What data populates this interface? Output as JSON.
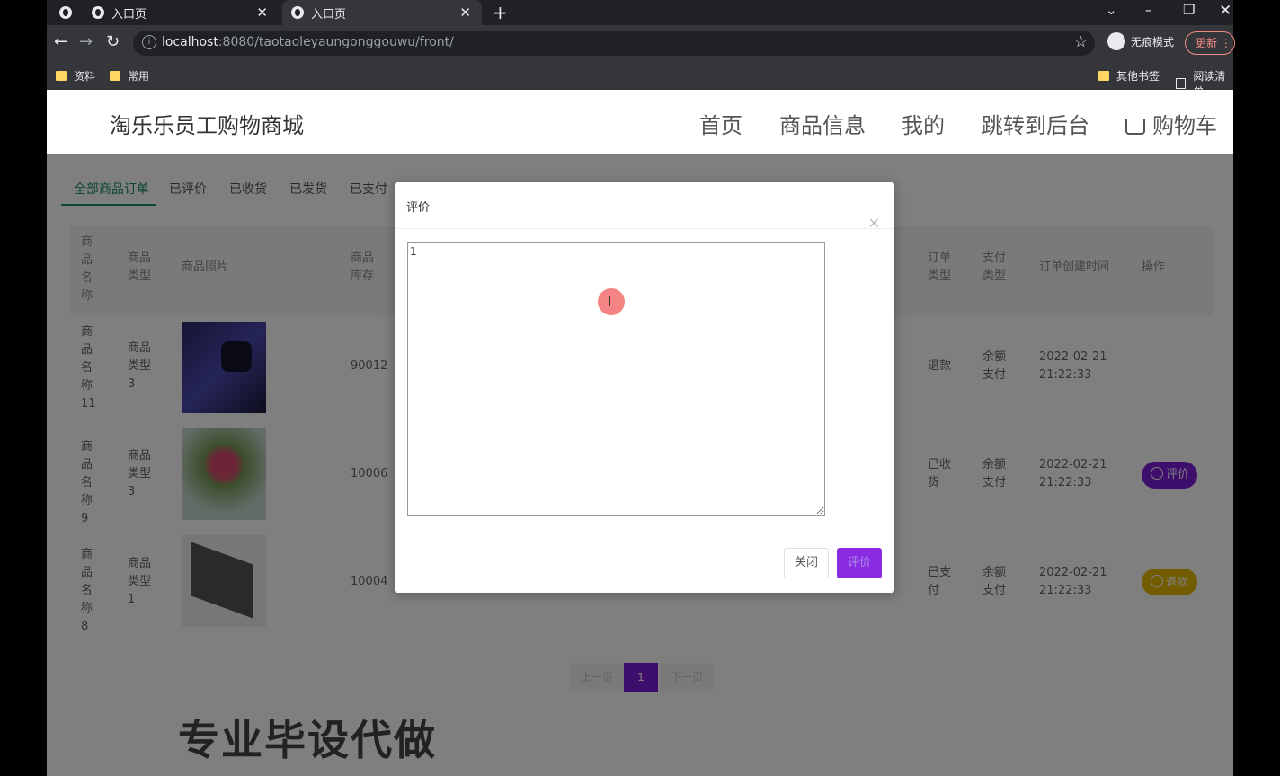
{
  "browser": {
    "tabs": [
      {
        "label": ""
      },
      {
        "label": "入口页"
      },
      {
        "label": "入口页"
      }
    ],
    "url_host": "localhost",
    "url_rest": ":8080/taotaoleyaungonggouwu/front/",
    "incognito_label": "无痕模式",
    "update_label": "更新",
    "bookmarks": [
      "资料",
      "常用"
    ],
    "bookmarks_right": [
      "其他书签",
      "阅读清单"
    ]
  },
  "site": {
    "title": "淘乐乐员工购物商城",
    "nav": [
      "首页",
      "商品信息",
      "我的",
      "跳转到后台",
      "购物车"
    ]
  },
  "order_tabs": [
    "全部商品订单",
    "已评价",
    "已收货",
    "已发货",
    "已支付"
  ],
  "table": {
    "headers": {
      "name": "商品名称",
      "type": "商品类型",
      "photo": "商品照片",
      "stock": "商品库存",
      "order_type": "订单类型",
      "pay_type": "支付类型",
      "created": "订单创建时间",
      "ops": "操作"
    },
    "rows": [
      {
        "name": "商品名称11",
        "type": "商品类型3",
        "stock": "90012",
        "order_type": "退款",
        "pay_type": "余额支付",
        "created_date": "2022-02-21",
        "created_time": "21:22:33"
      },
      {
        "name": "商品名称9",
        "type": "商品类型3",
        "stock": "10006",
        "order_type": "已收货",
        "pay_type": "余额支付",
        "created_date": "2022-02-21",
        "created_time": "21:22:33",
        "action": "评价"
      },
      {
        "name": "商品名称8",
        "type": "商品类型1",
        "stock": "10004",
        "order_type": "已支付",
        "pay_type": "余额支付",
        "created_date": "2022-02-21",
        "created_time": "21:22:33",
        "action": "退款"
      }
    ]
  },
  "pager": {
    "prev": "上一页",
    "current": "1",
    "next": "下一页"
  },
  "watermark": "专业毕设代做",
  "dialog": {
    "title": "评价",
    "text_value": "1",
    "close_label": "关闭",
    "submit_label": "评价"
  },
  "colors": {
    "accent": "#7c1dd9",
    "tab_active": "#1a8a6d",
    "refund": "#e6b800"
  }
}
